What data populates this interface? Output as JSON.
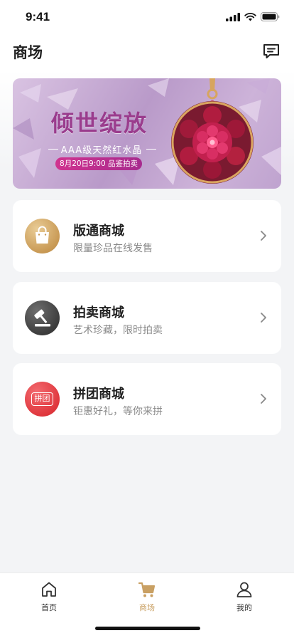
{
  "status_bar": {
    "time": "9:41"
  },
  "header": {
    "title": "商场"
  },
  "banner": {
    "title": "倾世绽放",
    "subtitle": "AAA级天然红水晶",
    "tag": "8月20日9:00 品鉴拍卖"
  },
  "cards": [
    {
      "title": "版通商城",
      "subtitle": "限量珍品在线发售",
      "icon": "shopping-bag-icon"
    },
    {
      "title": "拍卖商城",
      "subtitle": "艺术珍藏，限时拍卖",
      "icon": "gavel-icon"
    },
    {
      "title": "拼团商城",
      "subtitle": "钜惠好礼，等你来拼",
      "icon": "group-buy-icon",
      "icon_text": "拼团"
    }
  ],
  "tabbar": {
    "items": [
      {
        "label": "首页",
        "icon": "home-icon"
      },
      {
        "label": "商场",
        "icon": "cart-icon",
        "active": true
      },
      {
        "label": "我的",
        "icon": "user-icon"
      }
    ]
  },
  "colors": {
    "accent_gold": "#c9a063",
    "banner_purple": "#9a3c8d",
    "group_red": "#e0383e"
  }
}
